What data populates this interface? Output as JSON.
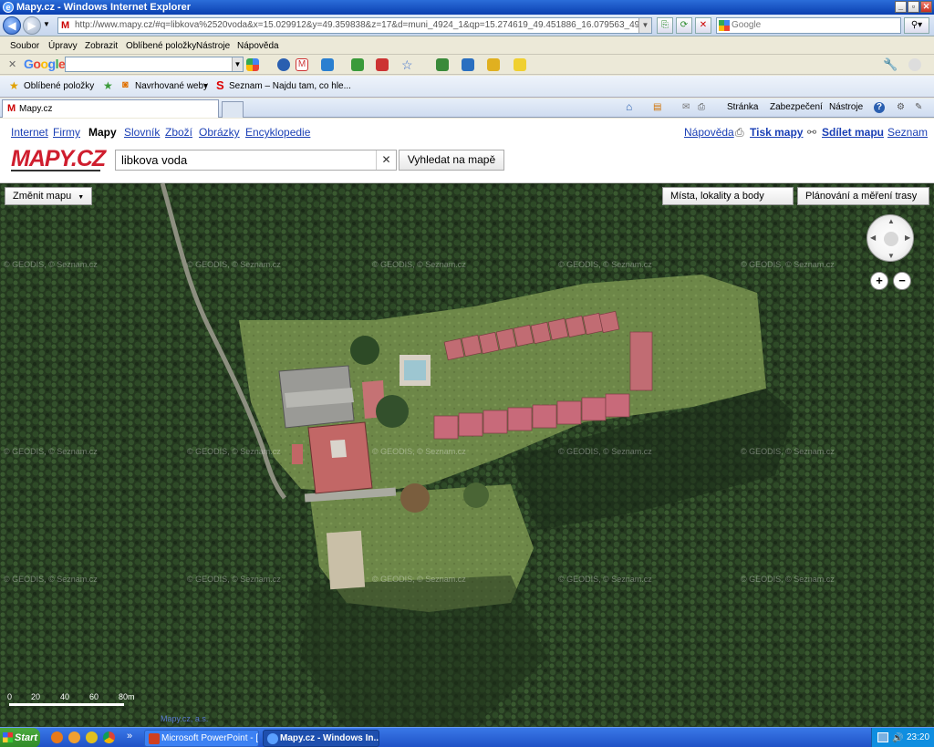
{
  "window": {
    "title": "Mapy.cz - Windows Internet Explorer"
  },
  "browser": {
    "url": "http://www.mapy.cz/#q=libkova%2520voda&x=15.029912&y=49.359838&z=17&d=muni_4924_1&qp=15.274619_49.451886_16.079563_49.875471_9",
    "search_placeholder": "Google",
    "menu": [
      "Soubor",
      "Úpravy",
      "Zobrazit",
      "Oblíbené položky",
      "Nástroje",
      "Nápověda"
    ],
    "google_toolbar_logo": "Google",
    "favorites": {
      "label": "Oblíbené položky",
      "items": [
        "Navrhované weby",
        "Seznam – Najdu tam, co hle..."
      ]
    },
    "tab_title": "Mapy.cz",
    "commands": [
      "Stránka",
      "Zabezpečení",
      "Nástroje"
    ]
  },
  "page": {
    "nav": [
      "Internet",
      "Firmy",
      "Mapy",
      "Slovník",
      "Zboží",
      "Obrázky",
      "Encyklopedie"
    ],
    "nav_active": "Mapy",
    "right_links": [
      "Nápověda",
      "Tisk mapy",
      "Sdílet mapu",
      "Seznam"
    ],
    "logo": "MAPY.CZ",
    "search_value": "libkova voda",
    "search_button": "Vyhledat na mapě"
  },
  "map": {
    "change_map_button": "Změnit mapu",
    "places_button": "Místa, lokality a body",
    "planning_button": "Plánování a měření trasy",
    "watermark": "© GEODIS, © Seznam.cz",
    "scale_labels": [
      "0",
      "20",
      "40",
      "60",
      "80"
    ],
    "scale_unit": "m",
    "copyright": "Mapy.cz, a.s."
  },
  "taskbar": {
    "start": "Start",
    "items": [
      "Microsoft PowerPoint - [...",
      "Mapy.cz - Windows In..."
    ],
    "clock": "23:20"
  },
  "colors": {
    "title_bar": "#0a3fb0",
    "link": "#1a3fb5",
    "logo_red": "#cf1e2e",
    "forest": "#1f3320",
    "meadow": "#6f8a4a",
    "roof_red": "#c46a6a"
  }
}
